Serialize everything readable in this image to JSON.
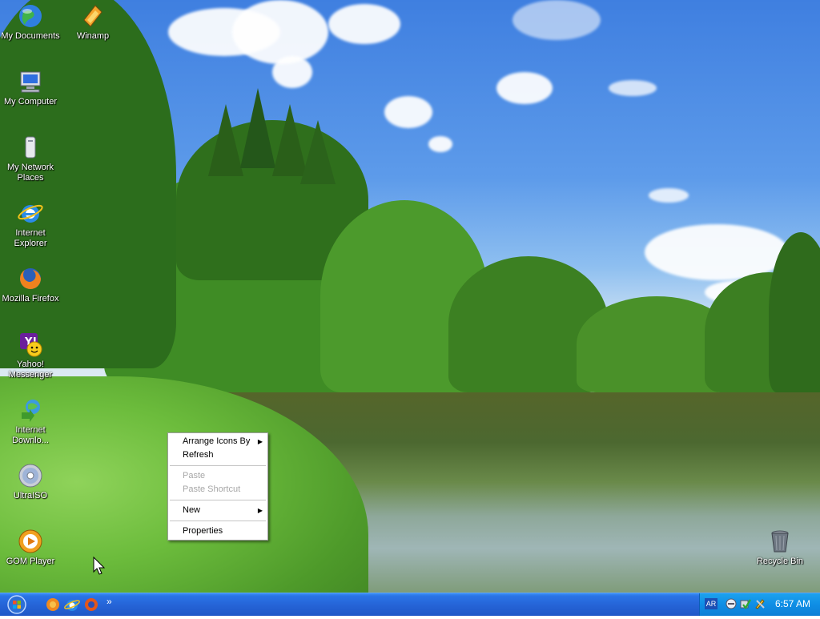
{
  "desktop": {
    "icons": [
      {
        "label": "My Documents"
      },
      {
        "label": "Winamp"
      },
      {
        "label": "My Computer"
      },
      {
        "label": "My Network Places"
      },
      {
        "label": "Internet Explorer"
      },
      {
        "label": "Mozilla Firefox"
      },
      {
        "label": "Yahoo! Messenger"
      },
      {
        "label": "Internet Downlo..."
      },
      {
        "label": "UltraISO"
      },
      {
        "label": "GOM Player"
      },
      {
        "label": "Recycle Bin"
      }
    ]
  },
  "context_menu": {
    "items": [
      {
        "label": "Arrange Icons By",
        "submenu": "▶"
      },
      {
        "label": "Refresh"
      },
      {
        "label": "Paste"
      },
      {
        "label": "Paste Shortcut"
      },
      {
        "label": "New",
        "submenu": "▶"
      },
      {
        "label": "Properties"
      }
    ]
  },
  "taskbar": {
    "quicklaunch_expand": "»",
    "tray": {
      "language": "AR",
      "clock": "6:57 AM"
    }
  },
  "icons": {
    "start": "windows-flag-icon",
    "quicklaunch": [
      "firefox-icon",
      "internet-explorer-icon",
      "media-player-icon"
    ],
    "tray": [
      "network-icon",
      "security-check-icon",
      "tools-icon"
    ]
  }
}
